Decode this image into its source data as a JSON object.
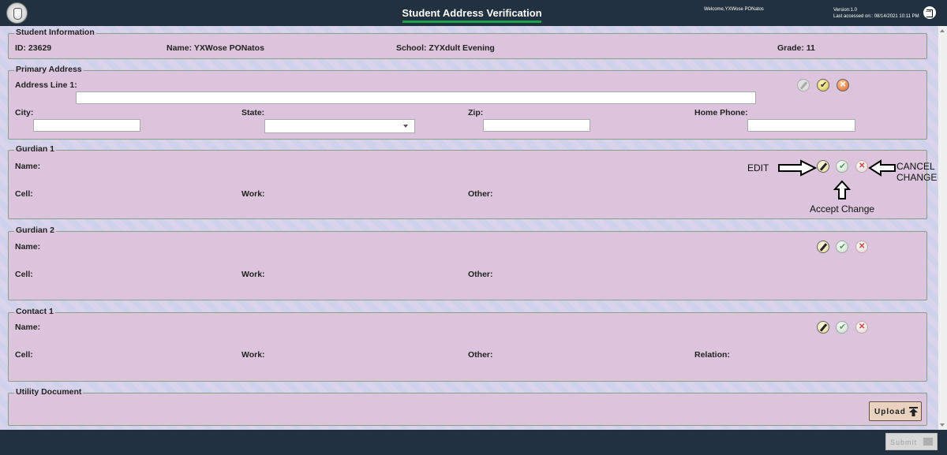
{
  "header": {
    "title": "Student Address Verification",
    "welcome": "Welcome,YXWose PONatos",
    "version": "Version:1.0",
    "last_accessed": "Last accessed on:: 08/14/2021 10:11 PM"
  },
  "student_info": {
    "legend": "Student Information",
    "id_label": "ID:",
    "id": "23629",
    "name_label": "Name:",
    "name": "YXWose PONatos",
    "school_label": "School:",
    "school": "ZYXdult Evening",
    "grade_label": "Grade:",
    "grade": "11"
  },
  "primary_address": {
    "legend": "Primary Address",
    "address_line1_label": "Address Line 1:",
    "address_line1_value": "",
    "city_label": "City:",
    "city_value": "",
    "state_label": "State:",
    "state_value": "",
    "zip_label": "Zip:",
    "zip_value": "",
    "home_phone_label": "Home Phone:",
    "home_phone_value": ""
  },
  "guardian1": {
    "legend": "Gurdian 1",
    "name_label": "Name:",
    "cell_label": "Cell:",
    "work_label": "Work:",
    "other_label": "Other:"
  },
  "guardian2": {
    "legend": "Gurdian 2",
    "name_label": "Name:",
    "cell_label": "Cell:",
    "work_label": "Work:",
    "other_label": "Other:"
  },
  "contact1": {
    "legend": "Contact 1",
    "name_label": "Name:",
    "cell_label": "Cell:",
    "work_label": "Work:",
    "other_label": "Other:",
    "relation_label": "Relation:"
  },
  "utility": {
    "legend": "Utility Document",
    "upload_label": "Upload"
  },
  "annotations": {
    "edit": "EDIT",
    "cancel_line1": "CANCEL",
    "cancel_line2": "CHANGE",
    "accept": "Accept Change"
  },
  "footer": {
    "submit_label": "Submit"
  },
  "icons": [
    "logo-icon",
    "logout-icon",
    "edit-icon",
    "accept-icon",
    "cancel-icon",
    "upload-icon",
    "submit-icon"
  ]
}
